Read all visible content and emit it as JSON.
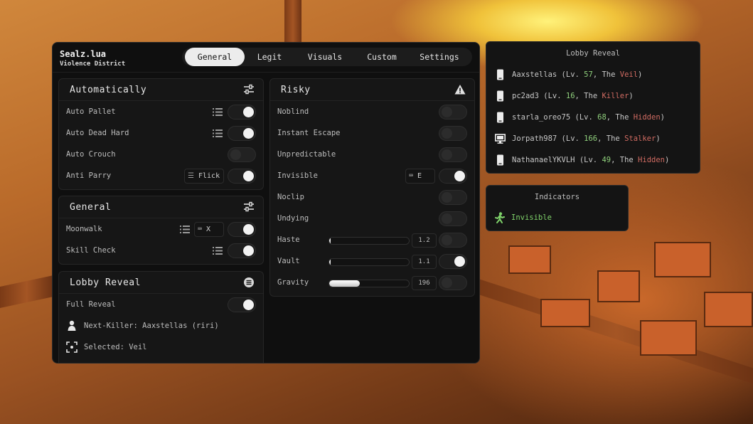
{
  "app": {
    "title": "Sealz.lua",
    "subtitle": "Violence District"
  },
  "tabs": [
    {
      "label": "General",
      "active": true
    },
    {
      "label": "Legit",
      "active": false
    },
    {
      "label": "Visuals",
      "active": false
    },
    {
      "label": "Custom",
      "active": false
    },
    {
      "label": "Settings",
      "active": false
    }
  ],
  "automatically": {
    "title": "Automatically",
    "icon": "sliders-icon",
    "rows": [
      {
        "label": "Auto Pallet",
        "on": true
      },
      {
        "label": "Auto Dead Hard",
        "on": true
      },
      {
        "label": "Auto Crouch",
        "on": false
      },
      {
        "label": "Anti Parry",
        "on": true,
        "mode": "Flick"
      }
    ]
  },
  "general": {
    "title": "General",
    "icon": "sliders-icon",
    "rows": [
      {
        "label": "Moonwalk",
        "on": true,
        "keybind": "X"
      },
      {
        "label": "Skill Check",
        "on": true
      }
    ]
  },
  "lobby_reveal_section": {
    "title": "Lobby Reveal",
    "full_reveal_label": "Full Reveal",
    "full_reveal_on": true,
    "next_killer": "Next-Killer: Aaxstellas (riri)",
    "selected": "Selected: Veil"
  },
  "risky": {
    "title": "Risky",
    "icon": "warning-icon",
    "rows": [
      {
        "label": "Noblind",
        "on": false
      },
      {
        "label": "Instant Escape",
        "on": false
      },
      {
        "label": "Unpredictable",
        "on": false
      },
      {
        "label": "Invisible",
        "on": true,
        "keybind": "E"
      },
      {
        "label": "Noclip",
        "on": false
      },
      {
        "label": "Undying",
        "on": false
      },
      {
        "label": "Haste",
        "on": false,
        "value": "1.2",
        "fill": 0.0
      },
      {
        "label": "Vault",
        "on": true,
        "value": "1.1",
        "fill": 0.0
      },
      {
        "label": "Gravity",
        "on": false,
        "value": "196",
        "fill": 0.38
      }
    ]
  },
  "lobby_panel": {
    "title": "Lobby Reveal",
    "players": [
      {
        "name": "Aaxstellas",
        "lv_prefix": "(Lv. ",
        "lv": "57",
        "mid": ", The ",
        "role": "Veil",
        "suffix": ")",
        "device": "phone-icon"
      },
      {
        "name": "pc2ad3",
        "lv_prefix": "(Lv. ",
        "lv": "16",
        "mid": ", The ",
        "role": "Killer",
        "suffix": ")",
        "device": "phone-icon"
      },
      {
        "name": "starla_oreo75",
        "lv_prefix": "(Lv. ",
        "lv": "68",
        "mid": ", The ",
        "role": "Hidden",
        "suffix": ")",
        "device": "phone-icon"
      },
      {
        "name": "Jorpath987",
        "lv_prefix": "(Lv. ",
        "lv": "166",
        "mid": ", The ",
        "role": "Stalker",
        "suffix": ")",
        "device": "monitor-icon"
      },
      {
        "name": "NathanaelYKVLH",
        "lv_prefix": "(Lv. ",
        "lv": "49",
        "mid": ", The ",
        "role": "Hidden",
        "suffix": ")",
        "device": "phone-icon"
      }
    ]
  },
  "indicators": {
    "title": "Indicators",
    "items": [
      {
        "label": "Invisible",
        "icon": "running-figure-icon"
      }
    ]
  },
  "colors": {
    "accent_green": "#8fcf7c",
    "role_red": "#d06b62",
    "indicator_green": "#7fd26a"
  }
}
